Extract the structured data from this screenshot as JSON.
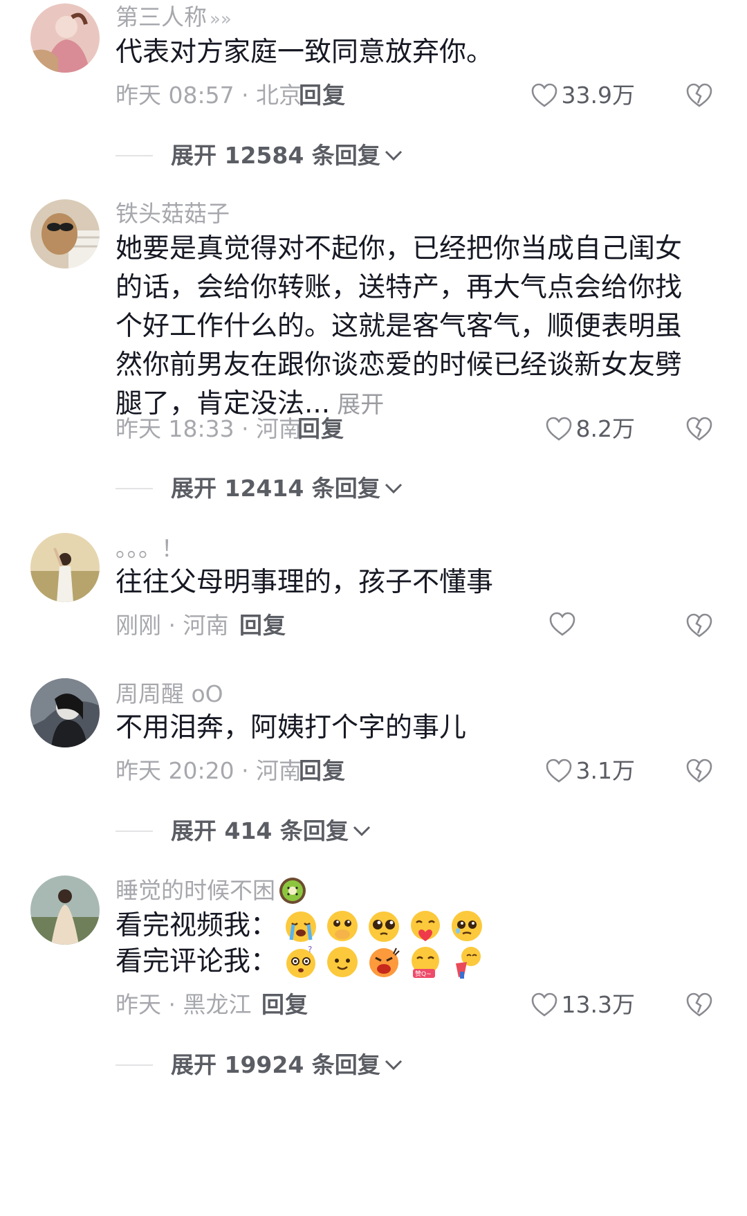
{
  "comments": [
    {
      "username": "第三人称",
      "username_suffix": "»»",
      "text": "代表对方家庭一致同意放弃你。",
      "meta": "昨天 08:57 · 北京",
      "reply_label": "回复",
      "likes": "33.9万",
      "expand_label": "展开 12584 条回复"
    },
    {
      "username": "铁头菇菇子",
      "text": "她要是真觉得对不起你，已经把你当成自己闺女的话，会给你转账，送特产，再大气点会给你找个好工作什么的。这就是客气客气，顺便表明虽然你前男友在跟你谈恋爱的时候已经谈新女友劈腿了，肯定没法...",
      "expand_text": "展开",
      "meta": "昨天 18:33 · 河南",
      "reply_label": "回复",
      "likes": "8.2万",
      "expand_label": "展开 12414 条回复"
    },
    {
      "username": "。。。！",
      "text": "往往父母明事理的，孩子不懂事",
      "meta": "刚刚 · 河南",
      "reply_label": "回复",
      "likes": ""
    },
    {
      "username": "周周醒 oO",
      "text": "不用泪奔，阿姨打个字的事儿",
      "meta": "昨天 20:20 · 河南",
      "reply_label": "回复",
      "likes": "3.1万",
      "expand_label": "展开 414 条回复"
    },
    {
      "username": "睡觉的时候不困",
      "username_emoji": "kiwi-emoji",
      "line1": "看完视频我：",
      "line2": "看完评论我：",
      "line1_emojis": [
        "crying-emoji",
        "covering-mouth-emoji",
        "pleading-emoji",
        "heart-hug-emoji",
        "teary-emoji"
      ],
      "line2_emojis": [
        "dizzy-emoji",
        "smile-emoji",
        "shouting-emoji",
        "zan-q-emoji",
        "hug-emoji"
      ],
      "meta": "昨天 · 黑龙江",
      "reply_label": "回复",
      "likes": "13.3万",
      "expand_label": "展开 19924 条回复"
    }
  ],
  "colors": {
    "text": "#161823",
    "secondary": "#a7a8ad",
    "action": "#5b5d64",
    "background": "#ffffff"
  },
  "icons": [
    "heart-outline-icon",
    "broken-heart-icon",
    "chevron-down-icon"
  ]
}
